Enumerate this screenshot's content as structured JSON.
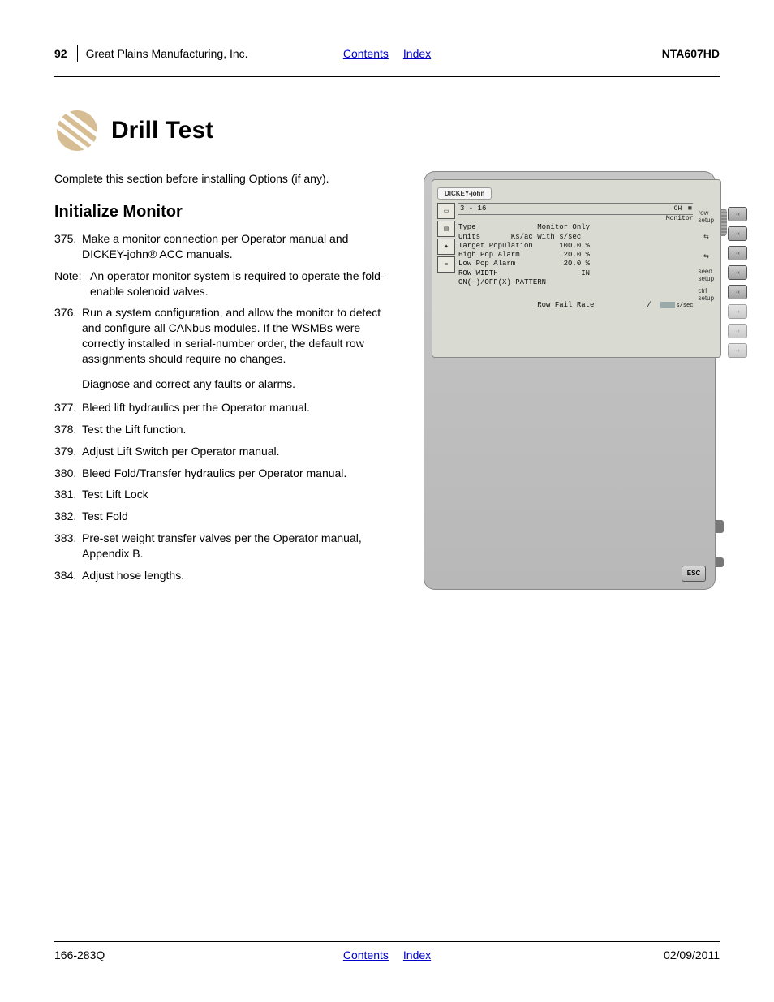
{
  "header": {
    "page": "92",
    "company": "Great Plains Manufacturing, Inc.",
    "contents": "Contents",
    "index": "Index",
    "model": "NTA607HD"
  },
  "title": "Drill Test",
  "intro": "Complete this section before installing Options (if any).",
  "subhead": "Initialize Monitor",
  "steps": {
    "s375": {
      "num": "375.",
      "text": "Make a monitor connection per Operator manual and DICKEY-john® ACC manuals."
    },
    "note": {
      "label": "Note:",
      "text": "An operator monitor system is required to operate the fold-enable solenoid valves."
    },
    "s376": {
      "num": "376.",
      "text": "Run a system configuration, and allow the monitor to detect and configure all CANbus modules. If the WSMBs were correctly installed in serial-number order, the default row assignments should require no changes."
    },
    "s376b": "Diagnose and correct any faults or alarms.",
    "s377": {
      "num": "377.",
      "text": "Bleed lift hydraulics per the Operator manual."
    },
    "s378": {
      "num": "378.",
      "text": "Test the Lift function."
    },
    "s379": {
      "num": "379.",
      "text": "Adjust Lift Switch per Operator manual."
    },
    "s380": {
      "num": "380.",
      "text": "Bleed Fold/Transfer hydraulics per Operator manual."
    },
    "s381": {
      "num": "381.",
      "text": "Test Lift Lock"
    },
    "s382": {
      "num": "382.",
      "text": "Test Fold"
    },
    "s383": {
      "num": "383.",
      "text": "Pre-set weight transfer valves per the Operator manual, Appendix B."
    },
    "s384": {
      "num": "384.",
      "text": "Adjust hose lengths."
    }
  },
  "monitor": {
    "brand": "DICKEY-john",
    "ch_label": "CH",
    "group": "3 - 16",
    "monitor_label": "Monitor",
    "type_row": "Type              Monitor Only",
    "units_row": "Units       Ks/ac with s/sec",
    "target_row": "Target Population      100.0 %",
    "highpop_row": "High Pop Alarm          20.0 %",
    "lowpop_row": "Low Pop Alarm           20.0 %",
    "rowwidth_row": "ROW WIDTH                   IN",
    "pattern_row": "ON(-)/OFF(X) PATTERN",
    "rowfail_row": "Row Fail Rate            /  ",
    "rowfail_unit": "s/sec",
    "soft_right": [
      "row setup",
      "",
      "",
      "seed setup",
      "ctrl setup"
    ],
    "esc": "ESC"
  },
  "footer": {
    "left": "166-283Q",
    "contents": "Contents",
    "index": "Index",
    "right": "02/09/2011"
  }
}
